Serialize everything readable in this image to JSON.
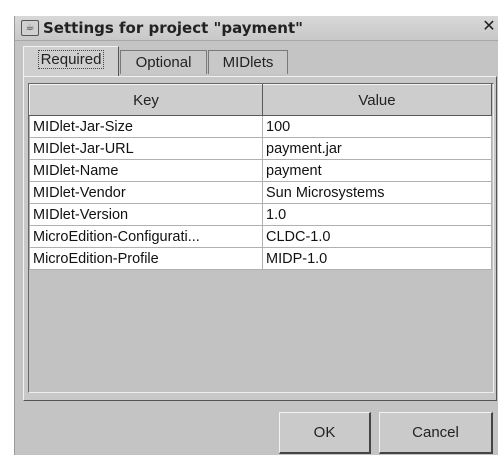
{
  "window": {
    "title": "Settings for project \"payment\"",
    "close_glyph": "✕"
  },
  "tabs": [
    {
      "label": "Required",
      "active": true
    },
    {
      "label": "Optional",
      "active": false
    },
    {
      "label": "MIDlets",
      "active": false
    }
  ],
  "table": {
    "columns": [
      "Key",
      "Value"
    ],
    "rows": [
      [
        "MIDlet-Jar-Size",
        "100"
      ],
      [
        "MIDlet-Jar-URL",
        "payment.jar"
      ],
      [
        "MIDlet-Name",
        "payment"
      ],
      [
        "MIDlet-Vendor",
        "Sun Microsystems"
      ],
      [
        "MIDlet-Version",
        "1.0"
      ],
      [
        "MicroEdition-Configurati...",
        "CLDC-1.0"
      ],
      [
        "MicroEdition-Profile",
        "MIDP-1.0"
      ]
    ]
  },
  "buttons": {
    "ok_label": "OK",
    "cancel_label": "Cancel"
  }
}
